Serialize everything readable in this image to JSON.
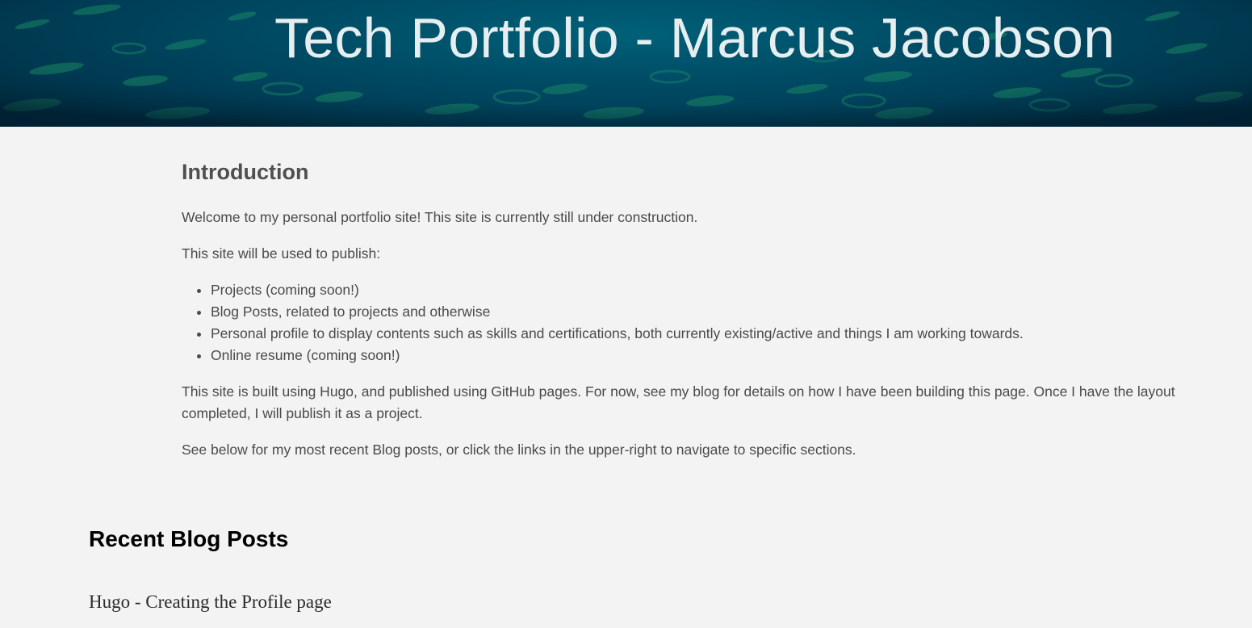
{
  "header": {
    "title": "Tech Portfolio - Marcus Jacobson"
  },
  "intro": {
    "heading": "Introduction",
    "paragraph_welcome": "Welcome to my personal portfolio site! This site is currently still under construction.",
    "paragraph_publish": "This site will be used to publish:",
    "list": [
      "Projects (coming soon!)",
      "Blog Posts, related to projects and otherwise",
      "Personal profile to display contents such as skills and certifications, both currently existing/active and things I am working towards.",
      "Online resume (coming soon!)"
    ],
    "paragraph_built": "This site is built using Hugo, and published using GitHub pages. For now, see my blog for details on how I have been building this page. Once I have the layout completed, I will publish it as a project.",
    "paragraph_see_below": "See below for my most recent Blog posts, or click the links in the upper-right to navigate to specific sections."
  },
  "recent_posts": {
    "heading": "Recent Blog Posts",
    "posts": [
      {
        "title": "Hugo - Creating the Profile page"
      }
    ]
  },
  "colors": {
    "page_background": "#f3f3f3",
    "banner_background": "#00465f",
    "banner_title": "#e6eef0",
    "body_text": "#4a4a4a"
  }
}
